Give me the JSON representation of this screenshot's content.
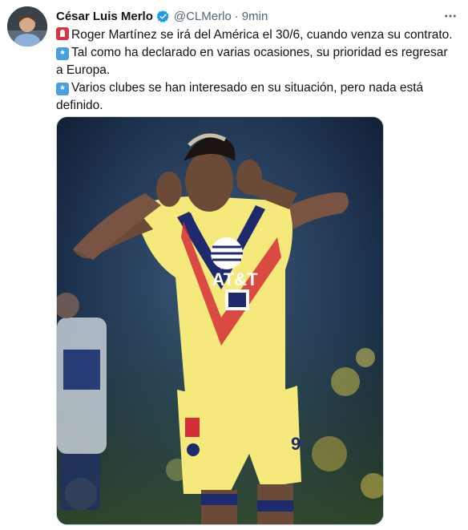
{
  "tweet": {
    "author_name": "César Luis Merlo",
    "handle": "@CLMerlo",
    "separator": "·",
    "time": "9min",
    "more_icon": "more-horizontal-icon",
    "verified_icon": "verified-badge-icon",
    "lines": [
      {
        "emoji": "siren-icon",
        "text": "Roger Martínez se irá del América el 30/6, cuando venza su contrato."
      },
      {
        "emoji": "asterisk-icon",
        "text": "Tal como ha declarado en varias ocasiones, su prioridad es regresar a Europa."
      },
      {
        "emoji": "asterisk-icon",
        "text": "Varios clubes se han interesado en su situación, pero nada está definido."
      }
    ],
    "media": {
      "jersey_sponsor": "AT&T",
      "jersey_number": "9"
    },
    "colors": {
      "verified": "#1d9bf0",
      "secondary_text": "#536471",
      "jersey_yellow": "#f4e97a",
      "jersey_navy": "#1e2a6e",
      "jersey_red": "#d62d3a"
    }
  }
}
